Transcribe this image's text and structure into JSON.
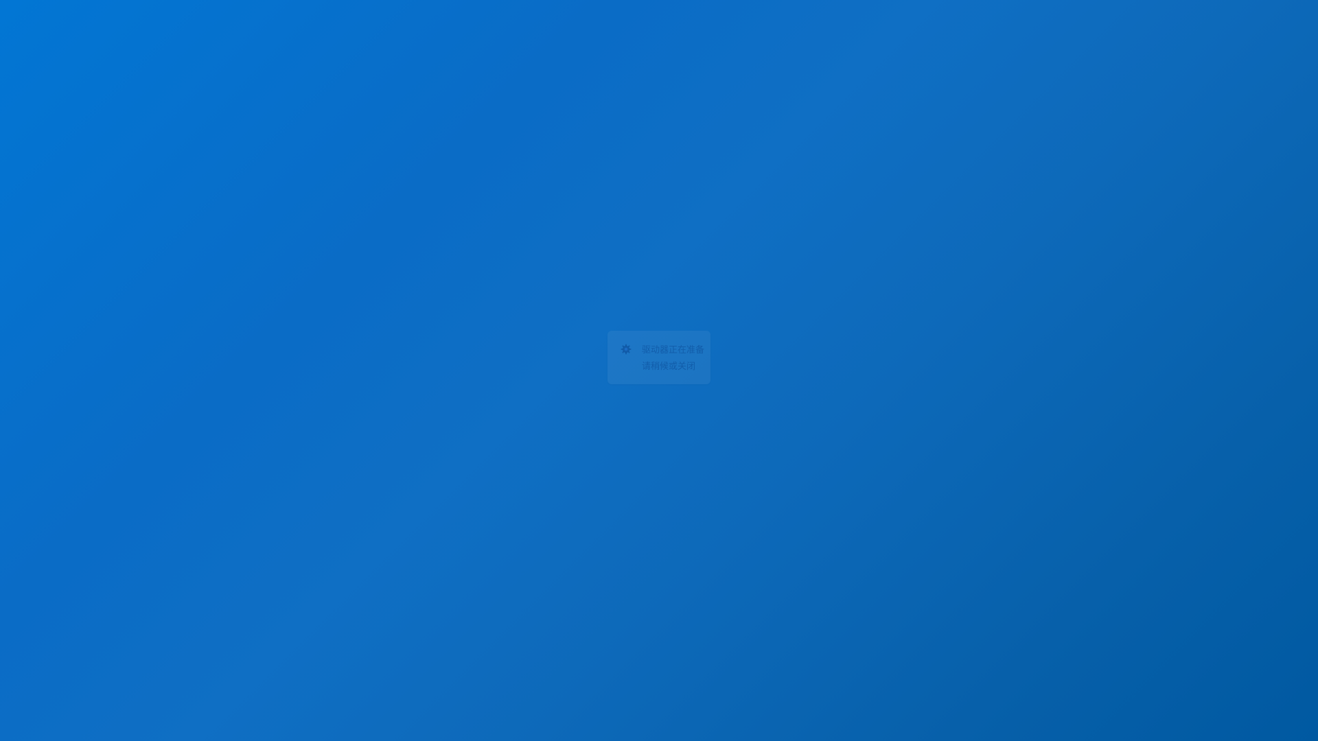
{
  "colors": {
    "background_start": "#0276d4",
    "background_end": "#0059a1",
    "notice_text": "#0a4896"
  },
  "notice": {
    "icon": "gear-icon",
    "line1": "驱动器正在准备",
    "line2": "请稍候或关闭"
  }
}
